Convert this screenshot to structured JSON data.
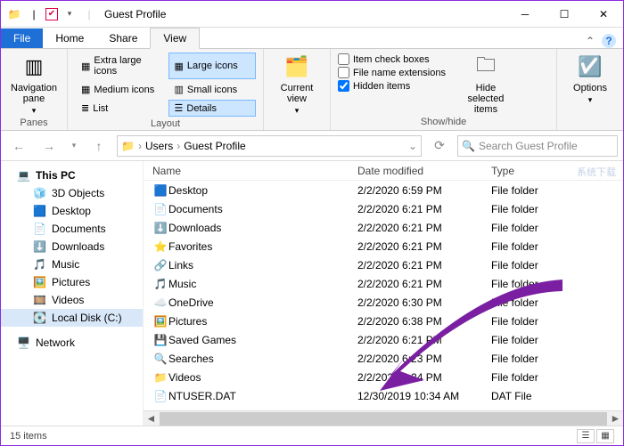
{
  "window": {
    "title": "Guest Profile"
  },
  "tabs": {
    "file": "File",
    "home": "Home",
    "share": "Share",
    "view": "View"
  },
  "ribbon": {
    "panes": {
      "nav_pane": "Navigation\npane",
      "label": "Panes"
    },
    "layout": {
      "extra_large": "Extra large icons",
      "large": "Large icons",
      "medium": "Medium icons",
      "small": "Small icons",
      "list": "List",
      "details": "Details",
      "label": "Layout"
    },
    "current_view": {
      "btn": "Current\nview"
    },
    "showhide": {
      "item_check": "Item check boxes",
      "file_ext": "File name extensions",
      "hidden": "Hidden items",
      "hide_selected": "Hide selected\nitems",
      "label": "Show/hide"
    },
    "options": "Options"
  },
  "breadcrumb": {
    "seg1": "Users",
    "seg2": "Guest Profile"
  },
  "search": {
    "placeholder": "Search Guest Profile"
  },
  "nav": {
    "this_pc": "This PC",
    "objects3d": "3D Objects",
    "desktop": "Desktop",
    "documents": "Documents",
    "downloads": "Downloads",
    "music": "Music",
    "pictures": "Pictures",
    "videos": "Videos",
    "local_disk": "Local Disk (C:)",
    "network": "Network"
  },
  "columns": {
    "name": "Name",
    "date": "Date modified",
    "type": "Type"
  },
  "files": [
    {
      "icon": "🟦",
      "name": "Desktop",
      "date": "2/2/2020 6:59 PM",
      "type": "File folder"
    },
    {
      "icon": "📄",
      "name": "Documents",
      "date": "2/2/2020 6:21 PM",
      "type": "File folder"
    },
    {
      "icon": "⬇️",
      "name": "Downloads",
      "date": "2/2/2020 6:21 PM",
      "type": "File folder"
    },
    {
      "icon": "⭐",
      "name": "Favorites",
      "date": "2/2/2020 6:21 PM",
      "type": "File folder"
    },
    {
      "icon": "🔗",
      "name": "Links",
      "date": "2/2/2020 6:21 PM",
      "type": "File folder"
    },
    {
      "icon": "🎵",
      "name": "Music",
      "date": "2/2/2020 6:21 PM",
      "type": "File folder"
    },
    {
      "icon": "☁️",
      "name": "OneDrive",
      "date": "2/2/2020 6:30 PM",
      "type": "File folder"
    },
    {
      "icon": "🖼️",
      "name": "Pictures",
      "date": "2/2/2020 6:38 PM",
      "type": "File folder"
    },
    {
      "icon": "💾",
      "name": "Saved Games",
      "date": "2/2/2020 6:21 PM",
      "type": "File folder"
    },
    {
      "icon": "🔍",
      "name": "Searches",
      "date": "2/2/2020 6:23 PM",
      "type": "File folder"
    },
    {
      "icon": "📁",
      "name": "Videos",
      "date": "2/2/2020 6:24 PM",
      "type": "File folder"
    },
    {
      "icon": "📄",
      "name": "NTUSER.DAT",
      "date": "12/30/2019 10:34 AM",
      "type": "DAT File"
    }
  ],
  "status": {
    "count": "15 items"
  },
  "watermark": "系统下载"
}
